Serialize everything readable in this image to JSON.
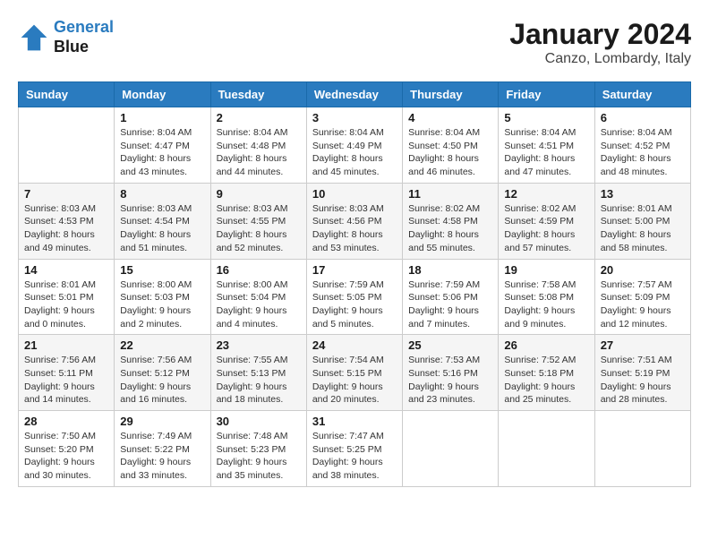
{
  "logo": {
    "line1": "General",
    "line2": "Blue"
  },
  "title": "January 2024",
  "subtitle": "Canzo, Lombardy, Italy",
  "header_days": [
    "Sunday",
    "Monday",
    "Tuesday",
    "Wednesday",
    "Thursday",
    "Friday",
    "Saturday"
  ],
  "weeks": [
    [
      {
        "day": "",
        "info": ""
      },
      {
        "day": "1",
        "info": "Sunrise: 8:04 AM\nSunset: 4:47 PM\nDaylight: 8 hours\nand 43 minutes."
      },
      {
        "day": "2",
        "info": "Sunrise: 8:04 AM\nSunset: 4:48 PM\nDaylight: 8 hours\nand 44 minutes."
      },
      {
        "day": "3",
        "info": "Sunrise: 8:04 AM\nSunset: 4:49 PM\nDaylight: 8 hours\nand 45 minutes."
      },
      {
        "day": "4",
        "info": "Sunrise: 8:04 AM\nSunset: 4:50 PM\nDaylight: 8 hours\nand 46 minutes."
      },
      {
        "day": "5",
        "info": "Sunrise: 8:04 AM\nSunset: 4:51 PM\nDaylight: 8 hours\nand 47 minutes."
      },
      {
        "day": "6",
        "info": "Sunrise: 8:04 AM\nSunset: 4:52 PM\nDaylight: 8 hours\nand 48 minutes."
      }
    ],
    [
      {
        "day": "7",
        "info": "Sunrise: 8:03 AM\nSunset: 4:53 PM\nDaylight: 8 hours\nand 49 minutes."
      },
      {
        "day": "8",
        "info": "Sunrise: 8:03 AM\nSunset: 4:54 PM\nDaylight: 8 hours\nand 51 minutes."
      },
      {
        "day": "9",
        "info": "Sunrise: 8:03 AM\nSunset: 4:55 PM\nDaylight: 8 hours\nand 52 minutes."
      },
      {
        "day": "10",
        "info": "Sunrise: 8:03 AM\nSunset: 4:56 PM\nDaylight: 8 hours\nand 53 minutes."
      },
      {
        "day": "11",
        "info": "Sunrise: 8:02 AM\nSunset: 4:58 PM\nDaylight: 8 hours\nand 55 minutes."
      },
      {
        "day": "12",
        "info": "Sunrise: 8:02 AM\nSunset: 4:59 PM\nDaylight: 8 hours\nand 57 minutes."
      },
      {
        "day": "13",
        "info": "Sunrise: 8:01 AM\nSunset: 5:00 PM\nDaylight: 8 hours\nand 58 minutes."
      }
    ],
    [
      {
        "day": "14",
        "info": "Sunrise: 8:01 AM\nSunset: 5:01 PM\nDaylight: 9 hours\nand 0 minutes."
      },
      {
        "day": "15",
        "info": "Sunrise: 8:00 AM\nSunset: 5:03 PM\nDaylight: 9 hours\nand 2 minutes."
      },
      {
        "day": "16",
        "info": "Sunrise: 8:00 AM\nSunset: 5:04 PM\nDaylight: 9 hours\nand 4 minutes."
      },
      {
        "day": "17",
        "info": "Sunrise: 7:59 AM\nSunset: 5:05 PM\nDaylight: 9 hours\nand 5 minutes."
      },
      {
        "day": "18",
        "info": "Sunrise: 7:59 AM\nSunset: 5:06 PM\nDaylight: 9 hours\nand 7 minutes."
      },
      {
        "day": "19",
        "info": "Sunrise: 7:58 AM\nSunset: 5:08 PM\nDaylight: 9 hours\nand 9 minutes."
      },
      {
        "day": "20",
        "info": "Sunrise: 7:57 AM\nSunset: 5:09 PM\nDaylight: 9 hours\nand 12 minutes."
      }
    ],
    [
      {
        "day": "21",
        "info": "Sunrise: 7:56 AM\nSunset: 5:11 PM\nDaylight: 9 hours\nand 14 minutes."
      },
      {
        "day": "22",
        "info": "Sunrise: 7:56 AM\nSunset: 5:12 PM\nDaylight: 9 hours\nand 16 minutes."
      },
      {
        "day": "23",
        "info": "Sunrise: 7:55 AM\nSunset: 5:13 PM\nDaylight: 9 hours\nand 18 minutes."
      },
      {
        "day": "24",
        "info": "Sunrise: 7:54 AM\nSunset: 5:15 PM\nDaylight: 9 hours\nand 20 minutes."
      },
      {
        "day": "25",
        "info": "Sunrise: 7:53 AM\nSunset: 5:16 PM\nDaylight: 9 hours\nand 23 minutes."
      },
      {
        "day": "26",
        "info": "Sunrise: 7:52 AM\nSunset: 5:18 PM\nDaylight: 9 hours\nand 25 minutes."
      },
      {
        "day": "27",
        "info": "Sunrise: 7:51 AM\nSunset: 5:19 PM\nDaylight: 9 hours\nand 28 minutes."
      }
    ],
    [
      {
        "day": "28",
        "info": "Sunrise: 7:50 AM\nSunset: 5:20 PM\nDaylight: 9 hours\nand 30 minutes."
      },
      {
        "day": "29",
        "info": "Sunrise: 7:49 AM\nSunset: 5:22 PM\nDaylight: 9 hours\nand 33 minutes."
      },
      {
        "day": "30",
        "info": "Sunrise: 7:48 AM\nSunset: 5:23 PM\nDaylight: 9 hours\nand 35 minutes."
      },
      {
        "day": "31",
        "info": "Sunrise: 7:47 AM\nSunset: 5:25 PM\nDaylight: 9 hours\nand 38 minutes."
      },
      {
        "day": "",
        "info": ""
      },
      {
        "day": "",
        "info": ""
      },
      {
        "day": "",
        "info": ""
      }
    ]
  ]
}
